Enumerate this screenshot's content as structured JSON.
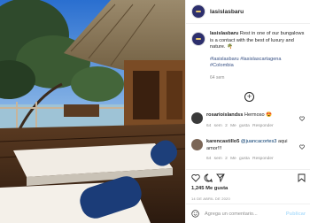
{
  "post": {
    "username": "lasislasbaru",
    "caption_user": "lasislasbaru",
    "caption_text": "Rest in one of our bungalows is a contact with the best of luxury and nature. 🌴",
    "hashtags": "#lasislasbaru #lasislascartagena #Colombia",
    "caption_time": "64 sem",
    "likes": "1,245 Me gusta",
    "date": "14 DE ABRIL DE 2020"
  },
  "comments": [
    {
      "user": "rosarioislandss",
      "text": "Hermoso 😍",
      "meta": "64 sem   2 Me gusta   Responder",
      "avatar_color": "#3a3a3a"
    },
    {
      "user": "karencastillo5",
      "mention": "@juancacortes3",
      "text": "aqui amor!!!",
      "meta": "64 sem   2 Me gusta   Responder",
      "avatar_color": "#7b6657"
    }
  ],
  "composer": {
    "placeholder": "Agrega un comentario...",
    "post_label": "Publicar"
  },
  "icons": {
    "more": "plus-circle-icon",
    "like": "heart-icon",
    "comment": "comment-icon",
    "share": "share-icon",
    "save": "bookmark-icon",
    "emoji": "emoji-icon"
  }
}
